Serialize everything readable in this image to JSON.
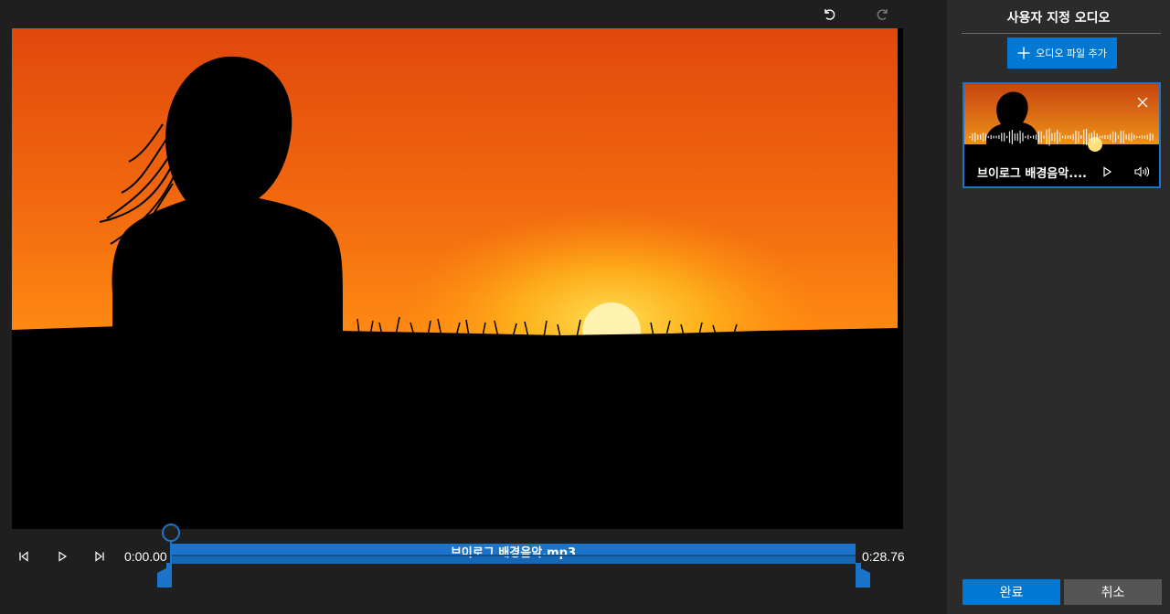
{
  "panel": {
    "title": "사용자 지정 오디오",
    "add_audio_label": "오디오 파일 추가",
    "audio_card": {
      "name": "브이로그 배경음악....",
      "icons": [
        "close-icon",
        "play-icon",
        "volume-icon"
      ]
    },
    "done_label": "완료",
    "cancel_label": "취소"
  },
  "toolbar": {
    "icons": [
      "undo-icon",
      "redo-icon"
    ]
  },
  "transport": {
    "icons": [
      "previous-frame-icon",
      "play-icon",
      "next-frame-icon"
    ],
    "start_time": "0:00.00",
    "end_time": "0:28.76"
  },
  "timeline": {
    "track_title": "브이로그 배경음악.mp3"
  },
  "colors": {
    "accent": "#0078d4",
    "track": "#1b74c9",
    "background": "#1f1f1f",
    "panel": "#2b2b2b",
    "cancel_button": "#555555"
  }
}
